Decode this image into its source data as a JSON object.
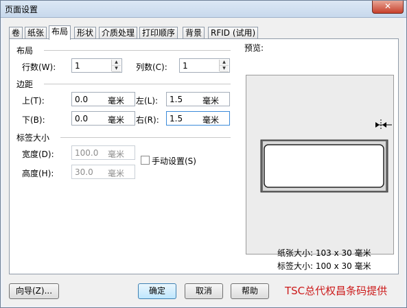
{
  "window": {
    "title": "页面设置",
    "close_glyph": "✕"
  },
  "tabs": [
    {
      "label": "卷"
    },
    {
      "label": "纸张"
    },
    {
      "label": "布局"
    },
    {
      "label": "形状"
    },
    {
      "label": "介质处理"
    },
    {
      "label": "打印顺序"
    },
    {
      "label": "背景"
    },
    {
      "label": "RFID (试用)"
    }
  ],
  "active_tab": "布局",
  "layout_section": {
    "title": "布局",
    "rows_label": "行数(W):",
    "rows_value": "1",
    "cols_label": "列数(C):",
    "cols_value": "1"
  },
  "margin_section": {
    "title": "边距",
    "top_label": "上(T):",
    "top_value": "0.0",
    "left_label": "左(L):",
    "left_value": "1.5",
    "bottom_label": "下(B):",
    "bottom_value": "0.0",
    "right_label": "右(R):",
    "right_value": "1.5",
    "unit": "毫米"
  },
  "label_size_section": {
    "title": "标签大小",
    "width_label": "宽度(D):",
    "width_value": "100.0",
    "height_label": "高度(H):",
    "height_value": "30.0",
    "unit": "毫米",
    "manual_label": "手动设置(S)",
    "manual_checked": false
  },
  "preview": {
    "title": "预览:",
    "paper_size": "纸张大小:  103 x 30  毫米",
    "label_size": "标签大小:  100 x 30  毫米"
  },
  "buttons": {
    "wizard": "向导(Z)...",
    "ok": "确定",
    "cancel": "取消",
    "help": "帮助"
  },
  "overlay_text": "TSC总代权昌条码提供",
  "colors": {
    "accent": "#3c7fb1",
    "watermark": "#cc1a1a",
    "close": "#c7402b"
  }
}
